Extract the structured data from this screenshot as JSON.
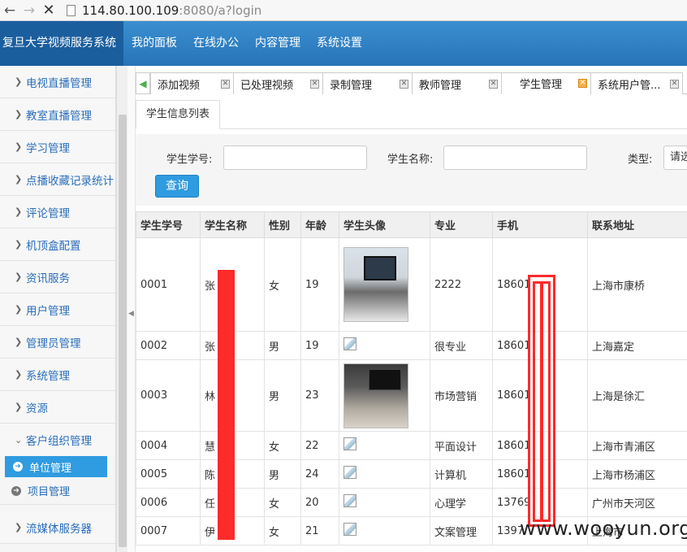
{
  "browser": {
    "back_icon": "arrow-left-icon",
    "forward_icon": "arrow-right-icon",
    "stop_icon": "close-icon",
    "url_host": "114.80.100.109",
    "url_rest": ":8080/a?login"
  },
  "header": {
    "brand": "复旦大学视频服务系统",
    "menu": [
      "我的面板",
      "在线办公",
      "内容管理",
      "系统设置"
    ],
    "colors": {
      "bar": "#2f82c6",
      "brand_bg": "#1a5e9e"
    }
  },
  "sidebar": {
    "items": [
      "电视直播管理",
      "教室直播管理",
      "学习管理",
      "点播收藏记录统计",
      "评论管理",
      "机顶盒配置",
      "资讯服务",
      "用户管理",
      "管理员管理",
      "系统管理",
      "资源",
      "客户组织管理"
    ],
    "subitems": [
      {
        "label": "单位管理",
        "active": true
      },
      {
        "label": "项目管理",
        "active": false
      }
    ],
    "last_item": "流媒体服务器"
  },
  "tabs": [
    {
      "label": "添加视频",
      "active": false
    },
    {
      "label": "已处理视频",
      "active": false
    },
    {
      "label": "录制管理",
      "active": false
    },
    {
      "label": "教师管理",
      "active": false
    },
    {
      "label": "学生管理",
      "active": true
    },
    {
      "label": "系统用户管...",
      "active": false
    }
  ],
  "subtab": {
    "label": "学生信息列表"
  },
  "filter": {
    "student_no_label": "学生学号:",
    "student_name_label": "学生名称:",
    "type_label": "类型:",
    "type_value": "请选",
    "search_label": "查询"
  },
  "table": {
    "headers": [
      "学生学号",
      "学生名称",
      "性别",
      "年龄",
      "学生头像",
      "专业",
      "手机",
      "联系地址"
    ],
    "rows": [
      {
        "no": "0001",
        "name": "张",
        "gender": "女",
        "age": "19",
        "avatar": "photo",
        "major": "2222",
        "phone": "18601",
        "address": "上海市康桥"
      },
      {
        "no": "0002",
        "name": "张",
        "gender": "男",
        "age": "19",
        "avatar": "broken",
        "major": "很专业",
        "phone": "18601",
        "address": "上海嘉定"
      },
      {
        "no": "0003",
        "name": "林",
        "gender": "男",
        "age": "23",
        "avatar": "photo2",
        "major": "市场营销",
        "phone": "18601",
        "address": "上海是徐汇"
      },
      {
        "no": "0004",
        "name": "慧",
        "gender": "女",
        "age": "22",
        "avatar": "broken",
        "major": "平面设计",
        "phone": "18601",
        "address": "上海市青浦区"
      },
      {
        "no": "0005",
        "name": "陈",
        "gender": "男",
        "age": "24",
        "avatar": "broken",
        "major": "计算机",
        "phone": "18601",
        "address": "上海市杨浦区"
      },
      {
        "no": "0006",
        "name": "任",
        "gender": "女",
        "age": "20",
        "avatar": "broken",
        "major": "心理学",
        "phone": "13769",
        "address": "广州市天河区"
      },
      {
        "no": "0007",
        "name": "伊",
        "gender": "女",
        "age": "21",
        "avatar": "broken",
        "major": "文案管理",
        "phone": "1397",
        "address": "上海市"
      }
    ]
  },
  "watermark": "www.wooyun.org"
}
